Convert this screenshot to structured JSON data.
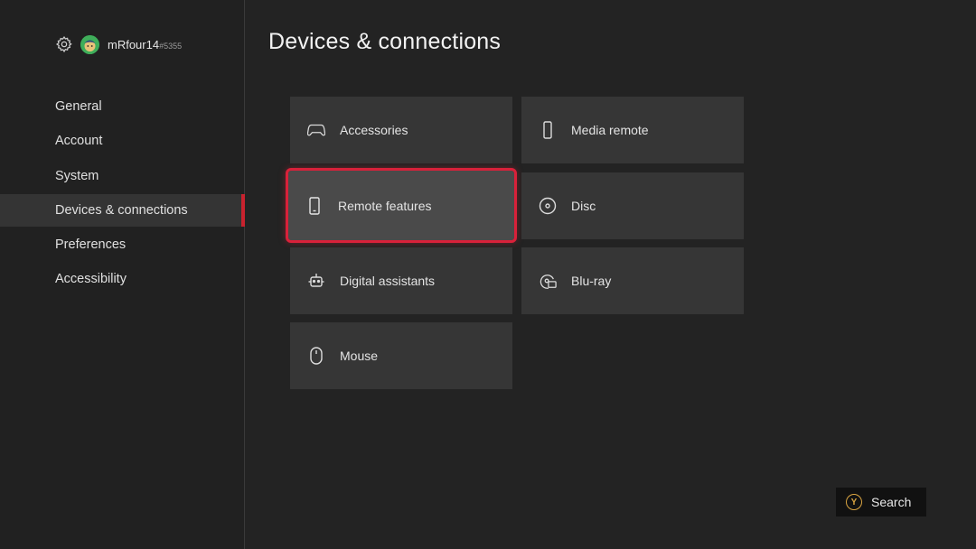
{
  "profile": {
    "gamertag": "mRfour14",
    "suffix": "#5355"
  },
  "sidebar": {
    "items": [
      {
        "label": "General"
      },
      {
        "label": "Account"
      },
      {
        "label": "System"
      },
      {
        "label": "Devices & connections"
      },
      {
        "label": "Preferences"
      },
      {
        "label": "Accessibility"
      }
    ],
    "active": "Devices & connections"
  },
  "main": {
    "title": "Devices & connections",
    "tiles": [
      {
        "label": "Accessories",
        "icon": "controller-icon"
      },
      {
        "label": "Media remote",
        "icon": "remote-icon"
      },
      {
        "label": "Remote features",
        "icon": "phone-icon"
      },
      {
        "label": "Disc",
        "icon": "disc-icon"
      },
      {
        "label": "Digital assistants",
        "icon": "assistant-icon"
      },
      {
        "label": "Blu-ray",
        "icon": "bluray-icon"
      },
      {
        "label": "Mouse",
        "icon": "mouse-icon"
      }
    ],
    "focused": "Remote features"
  },
  "hints": {
    "search_button": "Y",
    "search_label": "Search"
  },
  "colors": {
    "accent": "#d9213a",
    "background": "#232323",
    "tile": "#363636",
    "y_button": "#d9a441"
  }
}
